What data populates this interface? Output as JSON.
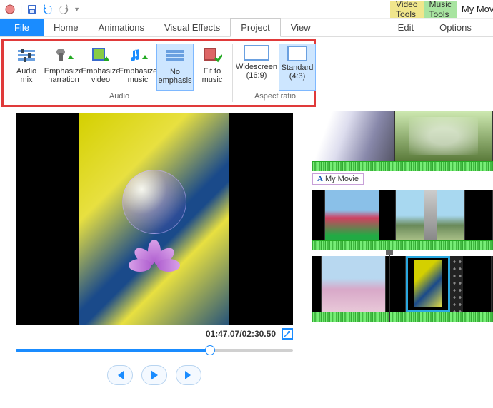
{
  "app_title": "My Movie - Movie M",
  "contextual": {
    "video": "Video Tools",
    "music": "Music Tools"
  },
  "tabs": {
    "file": "File",
    "home": "Home",
    "animations": "Animations",
    "visual_effects": "Visual Effects",
    "project": "Project",
    "view": "View",
    "edit": "Edit",
    "options": "Options"
  },
  "ribbon": {
    "audio": {
      "label": "Audio",
      "audio_mix": {
        "l1": "Audio",
        "l2": "mix"
      },
      "emph_narr": {
        "l1": "Emphasize",
        "l2": "narration"
      },
      "emph_video": {
        "l1": "Emphasize",
        "l2": "video"
      },
      "emph_music": {
        "l1": "Emphasize",
        "l2": "music"
      },
      "no_emph": {
        "l1": "No",
        "l2": "emphasis"
      },
      "fit_music": {
        "l1": "Fit to",
        "l2": "music"
      }
    },
    "aspect": {
      "label": "Aspect ratio",
      "wide": {
        "l1": "Widescreen",
        "l2": "(16:9)"
      },
      "std": {
        "l1": "Standard",
        "l2": "(4:3)"
      }
    }
  },
  "player": {
    "time": "01:47.07/02:30.50"
  },
  "timeline": {
    "caption_text": "My Movie"
  }
}
